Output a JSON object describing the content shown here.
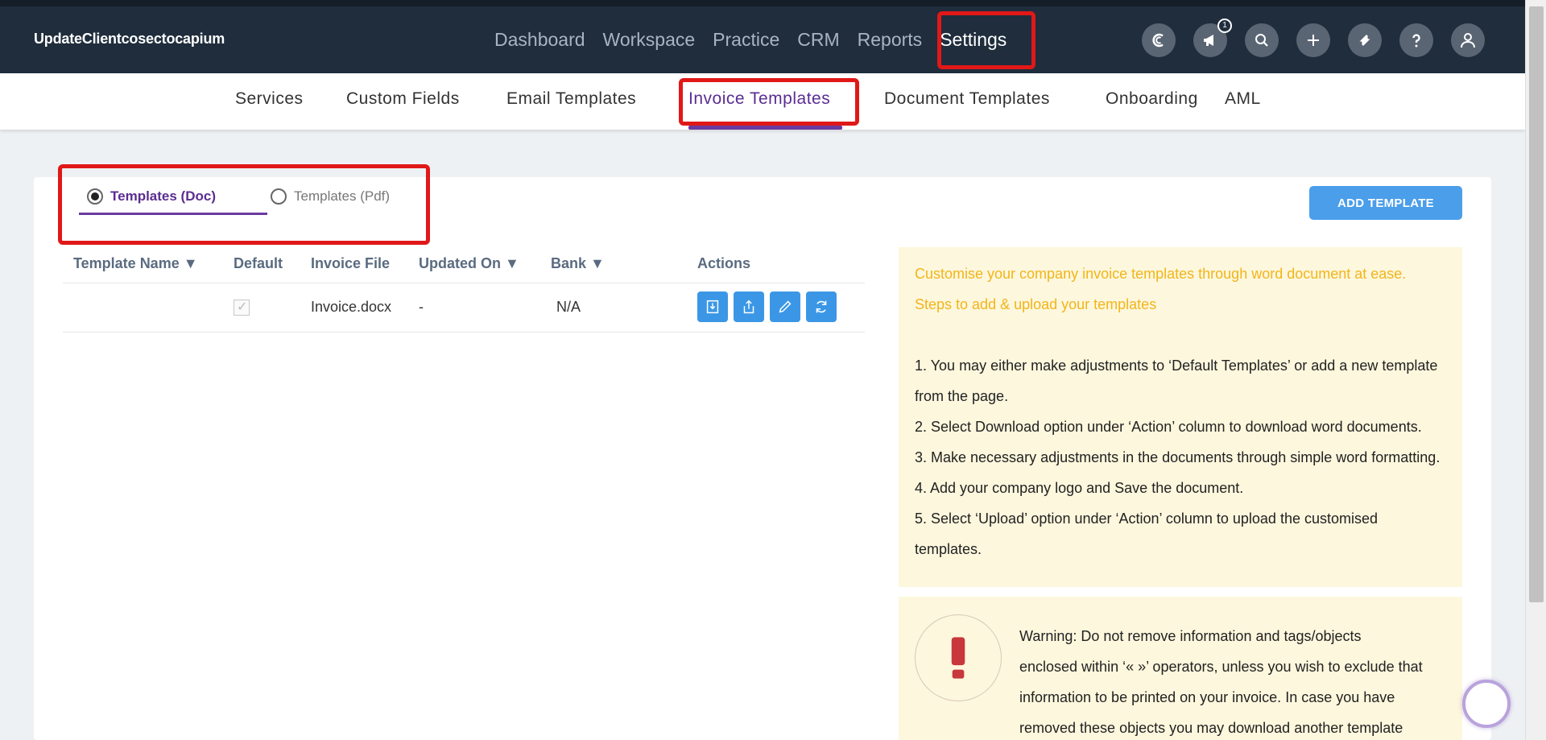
{
  "header": {
    "brand": "UpdateClientcosectocapium",
    "nav": [
      "Dashboard",
      "Workspace",
      "Practice",
      "CRM",
      "Reports",
      "Settings"
    ],
    "active_nav": "Settings",
    "notification_count": "1",
    "icons": [
      "capium-logo-icon",
      "megaphone-icon",
      "search-icon",
      "plus-icon",
      "ticket-icon",
      "help-icon",
      "user-icon"
    ]
  },
  "subnav": {
    "tabs": [
      "Services",
      "Custom Fields",
      "Email Templates",
      "Invoice Templates",
      "Document Templates",
      "Onboarding",
      "AML"
    ],
    "active": "Invoice Templates"
  },
  "template_type": {
    "doc": "Templates (Doc)",
    "pdf": "Templates (Pdf)",
    "selected": "doc"
  },
  "add_button": "ADD TEMPLATE",
  "table": {
    "headers": [
      "Template Name ▼",
      "Default",
      "Invoice File",
      "Updated On ▼",
      "Bank ▼",
      "Actions"
    ],
    "rows": [
      {
        "name": "",
        "default": true,
        "file": "Invoice.docx",
        "updated": "-",
        "bank": "N/A"
      }
    ]
  },
  "info": {
    "heading1": "Customise your company invoice templates through word document at ease.",
    "heading2": "Steps to add & upload your templates",
    "step1a": "1. You may either make adjustments to ‘Default Templates’ or add a new template",
    "step1b": "from the page.",
    "step2": "2. Select Download option under ‘Action’ column to download word documents.",
    "step3": "3. Make necessary adjustments in the documents through simple word formatting.",
    "step4": "4. Add your company logo and Save the document.",
    "step5a": "5. Select ‘Upload’ option under ‘Action’ column to upload the customised",
    "step5b": "templates."
  },
  "warning": {
    "line1": "Warning: Do not remove information and tags/objects",
    "line2": "enclosed within ‘« »’ operators, unless you wish to exclude that",
    "line3": "information to be printed on your invoice. In case you have",
    "line4": "removed these objects you may download another template"
  },
  "colors": {
    "header_bg": "#1f2d3d",
    "accent_purple": "#5a2d91",
    "action_blue": "#3b97e6",
    "highlight_red": "#e01818",
    "info_bg": "#fdf7dd",
    "info_heading": "#f2b51a"
  }
}
